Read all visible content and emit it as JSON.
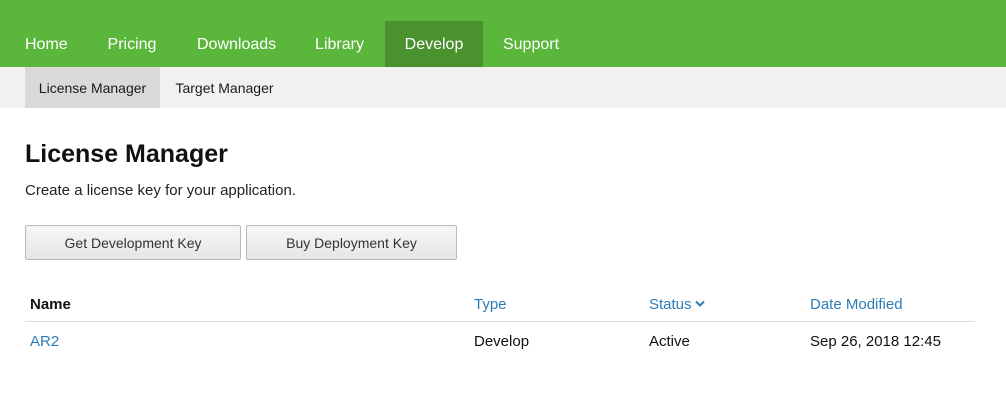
{
  "topnav": {
    "items": [
      {
        "label": "Home"
      },
      {
        "label": "Pricing"
      },
      {
        "label": "Downloads"
      },
      {
        "label": "Library"
      },
      {
        "label": "Develop",
        "active": true
      },
      {
        "label": "Support"
      }
    ]
  },
  "subnav": {
    "items": [
      {
        "label": "License Manager",
        "active": true
      },
      {
        "label": "Target Manager"
      }
    ]
  },
  "main": {
    "title": "License Manager",
    "description": "Create a license key for your application.",
    "buttons": {
      "get_dev_key": "Get Development Key",
      "buy_deploy_key": "Buy Deployment Key"
    }
  },
  "table": {
    "headers": {
      "name": "Name",
      "type": "Type",
      "status": "Status",
      "date_modified": "Date Modified"
    },
    "sort_icon": "chevron-down-icon",
    "rows": [
      {
        "name": "AR2",
        "type": "Develop",
        "status": "Active",
        "date_modified": "Sep 26, 2018 12:45"
      }
    ]
  },
  "colors": {
    "brand_green": "#5bb73b",
    "active_green": "#4a922e",
    "link_blue": "#2e7cb6"
  }
}
